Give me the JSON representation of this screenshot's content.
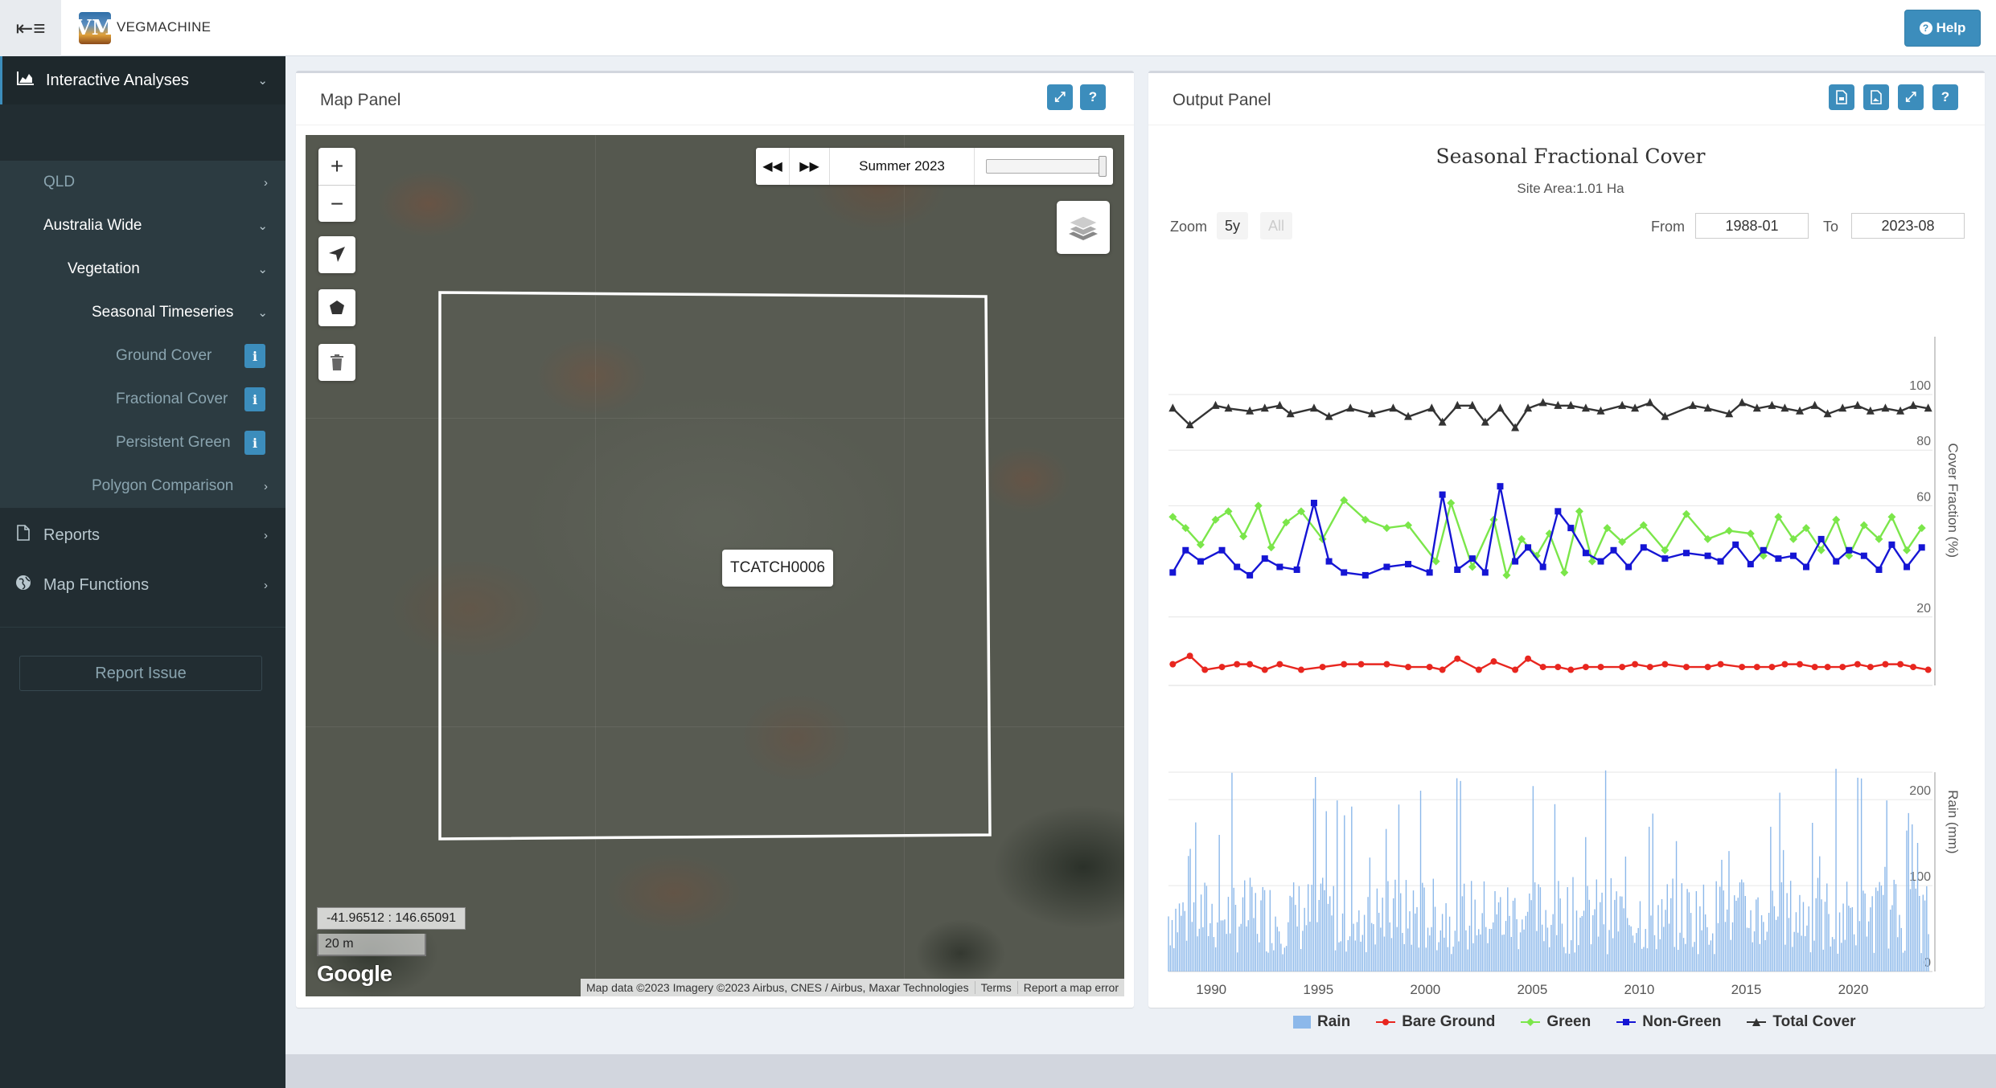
{
  "app": {
    "brand": "VEGMACHINE",
    "logo_text": "VM",
    "help_label": "Help"
  },
  "sidebar": {
    "items": [
      {
        "label": "Interactive Analyses"
      },
      {
        "label": "QLD"
      },
      {
        "label": "Australia Wide"
      },
      {
        "label": "Vegetation"
      },
      {
        "label": "Seasonal Timeseries"
      },
      {
        "label": "Ground Cover"
      },
      {
        "label": "Fractional Cover"
      },
      {
        "label": "Persistent Green"
      },
      {
        "label": "Polygon Comparison"
      },
      {
        "label": "Reports"
      },
      {
        "label": "Map Functions"
      }
    ],
    "report_issue": "Report Issue"
  },
  "map_panel": {
    "title": "Map Panel",
    "time_label": "Summer 2023",
    "slider_value": 1.0,
    "polygon_label": "TCATCH0006",
    "coords": "-41.96512 : 146.65091",
    "scale": "20 m",
    "google": "Google",
    "attribution": "Map data ©2023 Imagery ©2023 Airbus, CNES / Airbus, Maxar Technologies",
    "terms": "Terms",
    "report_error": "Report a map error"
  },
  "output_panel": {
    "title": "Output Panel",
    "zoom_label": "Zoom",
    "zoom_options": [
      "5y",
      "All"
    ],
    "from_label": "From",
    "from_value": "1988-01",
    "to_label": "To",
    "to_value": "2023-08"
  },
  "colors": {
    "accent": "#3c8dbc",
    "sidebar": "#222d32",
    "bare": "#e8261f",
    "green": "#7be64a",
    "nongreen": "#1515d4",
    "total": "#333333",
    "rain": "#8cb8ea"
  },
  "chart_data": {
    "type": "line",
    "title": "Seasonal Fractional Cover",
    "subtitle": "Site Area:1.01 Ha",
    "ylabel": "Cover Fraction (%)",
    "ylabel2": "Rain (mm)",
    "xlim": [
      1988,
      2023.7
    ],
    "ylim": [
      0,
      100
    ],
    "ylim2": [
      0,
      260
    ],
    "yticks": [
      20,
      60,
      80,
      100
    ],
    "yticks2": [
      0,
      100,
      200
    ],
    "xticks": [
      1990,
      1995,
      2000,
      2005,
      2010,
      2015,
      2020
    ],
    "legend": [
      "Rain",
      "Bare Ground",
      "Green",
      "Non-Green",
      "Total Cover"
    ],
    "series": [
      {
        "name": "Total Cover",
        "x": [
          1988.2,
          1989.0,
          1990.2,
          1990.8,
          1991.8,
          1992.5,
          1993.2,
          1993.7,
          1994.8,
          1995.5,
          1996.5,
          1997.5,
          1998.5,
          1999.2,
          2000.3,
          2000.8,
          2001.5,
          2002.2,
          2002.8,
          2003.5,
          2004.2,
          2004.8,
          2005.5,
          2006.2,
          2006.8,
          2007.5,
          2008.2,
          2009.2,
          2009.8,
          2010.5,
          2011.2,
          2012.5,
          2013.2,
          2014.2,
          2014.8,
          2015.5,
          2016.2,
          2016.8,
          2017.5,
          2018.2,
          2018.8,
          2019.5,
          2020.2,
          2020.8,
          2021.5,
          2022.2,
          2022.8,
          2023.5
        ],
        "values": [
          95,
          89,
          96,
          95,
          94,
          95,
          96,
          93,
          95,
          92,
          95,
          93,
          95,
          92,
          95,
          90,
          96,
          96,
          90,
          95,
          88,
          95,
          97,
          96,
          96,
          95,
          94,
          96,
          95,
          97,
          92,
          96,
          95,
          93,
          97,
          95,
          96,
          95,
          94,
          96,
          93,
          95,
          96,
          94,
          95,
          94,
          96,
          95
        ]
      },
      {
        "name": "Bare Ground",
        "x": [
          1988.2,
          1989.0,
          1989.7,
          1990.5,
          1991.2,
          1991.8,
          1992.5,
          1993.2,
          1994.2,
          1995.2,
          1996.2,
          1997.0,
          1998.2,
          1999.2,
          2000.2,
          2000.8,
          2001.5,
          2002.5,
          2003.2,
          2004.2,
          2004.8,
          2005.5,
          2006.2,
          2006.8,
          2007.5,
          2008.2,
          2009.2,
          2009.8,
          2010.5,
          2011.2,
          2012.2,
          2013.2,
          2013.8,
          2014.8,
          2015.5,
          2016.2,
          2016.8,
          2017.5,
          2018.2,
          2018.8,
          2019.5,
          2020.2,
          2020.8,
          2021.5,
          2022.2,
          2022.8,
          2023.5
        ],
        "values": [
          3,
          6,
          1,
          2,
          3,
          3,
          1,
          3,
          1,
          2,
          3,
          3,
          3,
          2,
          2,
          1,
          5,
          1,
          4,
          1,
          5,
          2,
          2,
          1,
          2,
          2,
          2,
          3,
          2,
          3,
          2,
          2,
          3,
          2,
          2,
          2,
          3,
          3,
          2,
          2,
          2,
          3,
          2,
          3,
          3,
          2,
          1
        ]
      },
      {
        "name": "Green",
        "x": [
          1988.2,
          1988.8,
          1989.5,
          1990.2,
          1990.8,
          1991.5,
          1992.2,
          1992.8,
          1993.5,
          1994.2,
          1995.2,
          1996.2,
          1997.2,
          1998.2,
          1999.2,
          2000.5,
          2001.2,
          2002.2,
          2003.2,
          2003.8,
          2004.5,
          2005.2,
          2005.8,
          2006.5,
          2007.2,
          2007.8,
          2008.5,
          2009.2,
          2010.2,
          2011.2,
          2012.2,
          2013.2,
          2014.2,
          2015.2,
          2015.8,
          2016.5,
          2017.2,
          2017.8,
          2018.5,
          2019.2,
          2019.8,
          2020.5,
          2021.2,
          2021.8,
          2022.5,
          2023.2
        ],
        "values": [
          56,
          52,
          46,
          55,
          58,
          49,
          60,
          45,
          54,
          58,
          48,
          62,
          55,
          52,
          53,
          40,
          61,
          38,
          55,
          35,
          48,
          42,
          50,
          36,
          58,
          40,
          52,
          47,
          53,
          44,
          57,
          48,
          51,
          50,
          42,
          56,
          48,
          52,
          44,
          55,
          42,
          53,
          48,
          56,
          44,
          52
        ]
      },
      {
        "name": "Non-Green",
        "x": [
          1988.2,
          1988.8,
          1989.5,
          1990.5,
          1991.2,
          1991.8,
          1992.5,
          1993.2,
          1994.0,
          1994.8,
          1995.5,
          1996.2,
          1997.2,
          1998.2,
          1999.2,
          2000.2,
          2000.8,
          2001.5,
          2002.2,
          2002.8,
          2003.5,
          2004.2,
          2004.8,
          2005.5,
          2006.2,
          2006.8,
          2007.5,
          2008.2,
          2008.8,
          2009.5,
          2010.2,
          2011.2,
          2012.2,
          2013.2,
          2013.8,
          2014.5,
          2015.2,
          2015.8,
          2016.5,
          2017.2,
          2017.8,
          2018.5,
          2019.2,
          2019.8,
          2020.5,
          2021.2,
          2021.8,
          2022.5,
          2023.2
        ],
        "values": [
          36,
          44,
          40,
          44,
          38,
          35,
          41,
          38,
          37,
          61,
          40,
          36,
          35,
          38,
          39,
          36,
          64,
          37,
          41,
          36,
          67,
          40,
          45,
          38,
          58,
          52,
          43,
          40,
          44,
          38,
          45,
          41,
          43,
          42,
          40,
          46,
          39,
          44,
          41,
          42,
          38,
          48,
          40,
          44,
          42,
          37,
          46,
          38,
          45
        ]
      },
      {
        "name": "Rain",
        "x_start": 1988,
        "x_end": 2023.6,
        "count": 420,
        "values_note": "monthly"
      }
    ]
  }
}
